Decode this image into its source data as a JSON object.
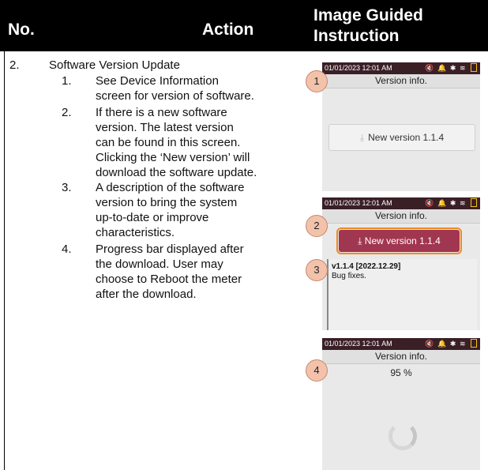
{
  "header": {
    "col_no": "No.",
    "col_action": "Action",
    "col_image": "Image Guided Instruction"
  },
  "row": {
    "number": "2.",
    "title": "Software Version Update",
    "steps": [
      {
        "num": "1.",
        "lines": [
          "See Device Information",
          "screen for version of software."
        ]
      },
      {
        "num": "2.",
        "lines": [
          "If there is a new software",
          "version. The latest version",
          "can be found in this screen.",
          "Clicking the ‘New version’ will",
          "download the software update."
        ]
      },
      {
        "num": "3.",
        "lines": [
          "A description of the software",
          "version to bring the system",
          "up-to-date or improve",
          "characteristics."
        ]
      },
      {
        "num": "4.",
        "lines": [
          "Progress bar displayed after",
          "the download. User may",
          "choose to Reboot the meter",
          "after the download."
        ]
      }
    ]
  },
  "screens": [
    {
      "status_time": "01/01/2023 12:01 AM",
      "title": "Version info.",
      "callout": "1",
      "button": "New version 1.1.4"
    },
    {
      "status_time": "01/01/2023 12:01 AM",
      "title": "Version info.",
      "callout_button": "2",
      "button": "New version 1.1.4",
      "callout_desc": "3",
      "desc_line1": "v1.1.4 [2022.12.29]",
      "desc_line2": "Bug fixes."
    },
    {
      "status_time": "01/01/2023 12:01 AM",
      "title": "Version info.",
      "callout": "4",
      "progress_text": "95 %",
      "progress": 0.95
    }
  ],
  "colors": {
    "header_bg": "#000000",
    "status_bar": "#3a1f27",
    "button_red": "#a13650",
    "highlight_orange": "#f08a1f",
    "callout_fill": "#f3c2ab"
  },
  "icons": [
    "download-icon",
    "mute-icon",
    "bell-icon",
    "bluetooth-icon",
    "wifi-icon",
    "battery-icon",
    "spinner-icon"
  ]
}
